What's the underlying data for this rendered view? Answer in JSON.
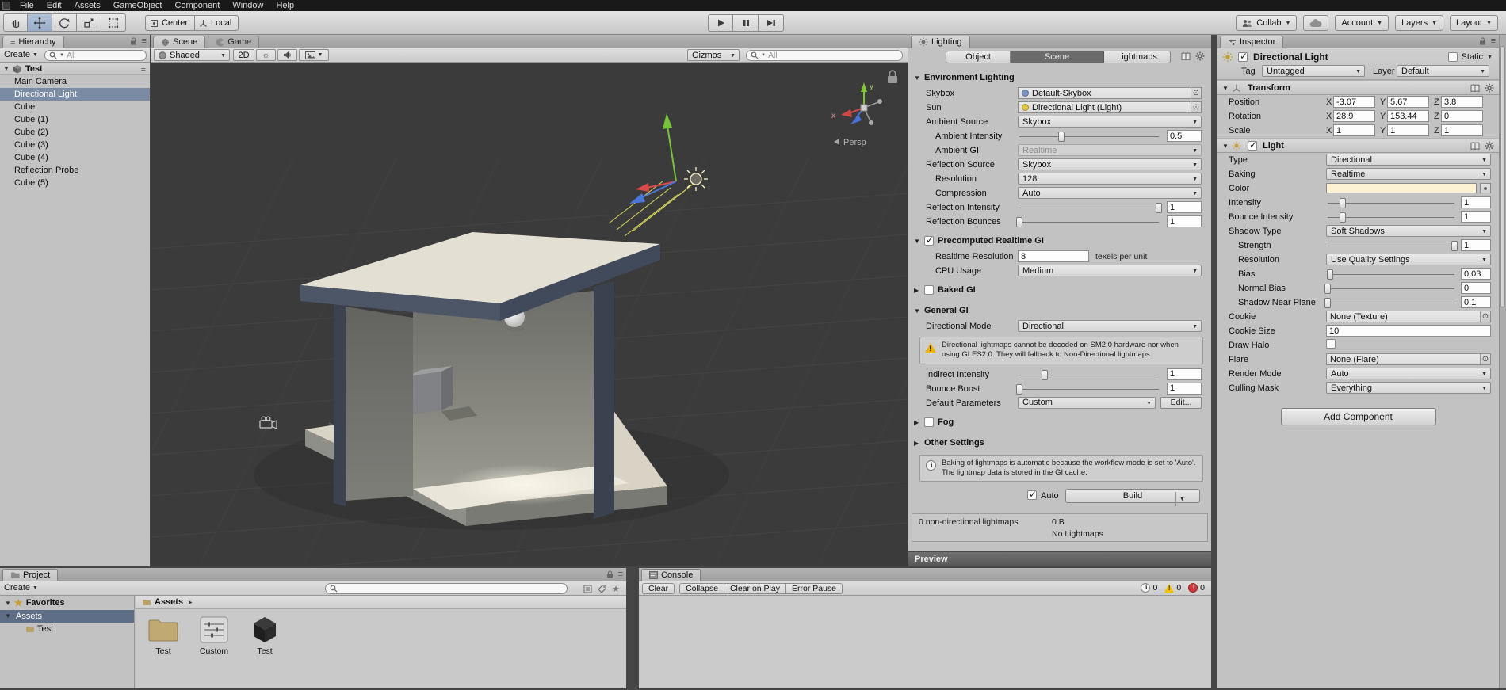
{
  "menu": {
    "items": [
      "File",
      "Edit",
      "Assets",
      "GameObject",
      "Component",
      "Window",
      "Help"
    ]
  },
  "toolbar": {
    "pivot_label": "Center",
    "space_label": "Local",
    "collab_label": "Collab",
    "account_label": "Account",
    "layers_label": "Layers",
    "layout_label": "Layout"
  },
  "hierarchy": {
    "tab_label": "Hierarchy",
    "create_label": "Create",
    "search_text": "All",
    "scene_name": "Test",
    "items": [
      {
        "label": "Main Camera",
        "selected": false
      },
      {
        "label": "Directional Light",
        "selected": true
      },
      {
        "label": "Cube",
        "selected": false
      },
      {
        "label": "Cube (1)",
        "selected": false
      },
      {
        "label": "Cube (2)",
        "selected": false
      },
      {
        "label": "Cube (3)",
        "selected": false
      },
      {
        "label": "Cube (4)",
        "selected": false
      },
      {
        "label": "Reflection Probe",
        "selected": false
      },
      {
        "label": "Cube (5)",
        "selected": false
      }
    ]
  },
  "scene": {
    "scene_tab": "Scene",
    "game_tab": "Game",
    "shading_label": "Shaded",
    "btn_2d": "2D",
    "gizmos_label": "Gizmos",
    "search_text": "All",
    "persp_label": "Persp",
    "axis_y_label": "y",
    "axis_x_label": "x"
  },
  "lighting": {
    "tab_label": "Lighting",
    "mode_tabs": [
      "Object",
      "Scene",
      "Lightmaps"
    ],
    "active_mode_tab": "Scene",
    "rows": [
      {
        "kind": "header",
        "label": "Environment Lighting",
        "open": true
      },
      {
        "kind": "object",
        "label": "Skybox",
        "value": "Default-Skybox",
        "indent": 1,
        "icon": "#7a93c9"
      },
      {
        "kind": "object",
        "label": "Sun",
        "value": "Directional Light (Light)",
        "indent": 1,
        "icon": "#e0c63e"
      },
      {
        "kind": "dropdown",
        "label": "Ambient Source",
        "value": "Skybox",
        "indent": 1
      },
      {
        "kind": "slider",
        "label": "Ambient Intensity",
        "value": "0.5",
        "pos": 30,
        "indent": 2
      },
      {
        "kind": "dropdown",
        "label": "Ambient GI",
        "value": "Realtime",
        "indent": 2,
        "disabled": true
      },
      {
        "kind": "dropdown",
        "label": "Reflection Source",
        "value": "Skybox",
        "indent": 1
      },
      {
        "kind": "dropdown",
        "label": "Resolution",
        "value": "128",
        "indent": 2
      },
      {
        "kind": "dropdown",
        "label": "Compression",
        "value": "Auto",
        "indent": 2
      },
      {
        "kind": "slider",
        "label": "Reflection Intensity",
        "value": "1",
        "pos": 100,
        "indent": 1
      },
      {
        "kind": "slider",
        "label": "Reflection Bounces",
        "value": "1",
        "pos": 0,
        "indent": 1
      },
      {
        "kind": "header",
        "label": "Precomputed Realtime GI",
        "open": true,
        "checkbox": true,
        "checked": true
      },
      {
        "kind": "field_unit",
        "label": "Realtime Resolution",
        "value": "8",
        "unit": "texels per unit",
        "indent": 2
      },
      {
        "kind": "dropdown",
        "label": "CPU Usage",
        "value": "Medium",
        "indent": 2
      },
      {
        "kind": "header",
        "label": "Baked GI",
        "open": false,
        "checkbox": true,
        "checked": false
      },
      {
        "kind": "header",
        "label": "General GI",
        "open": true
      },
      {
        "kind": "dropdown",
        "label": "Directional Mode",
        "value": "Directional",
        "indent": 1
      },
      {
        "kind": "warning",
        "text": "Directional lightmaps cannot be decoded on SM2.0 hardware nor when using GLES2.0. They will fallback to Non-Directional lightmaps."
      },
      {
        "kind": "slider",
        "label": "Indirect Intensity",
        "value": "1",
        "pos": 18,
        "indent": 1
      },
      {
        "kind": "slider",
        "label": "Bounce Boost",
        "value": "1",
        "pos": 0,
        "indent": 1
      },
      {
        "kind": "dropdown_button",
        "label": "Default Parameters",
        "value": "Custom",
        "button": "Edit...",
        "indent": 1
      },
      {
        "kind": "header",
        "label": "Fog",
        "open": false,
        "checkbox": true,
        "checked": false
      },
      {
        "kind": "header",
        "label": "Other Settings",
        "open": false
      },
      {
        "kind": "info",
        "text": "Baking of lightmaps is automatic because the workflow mode is set to 'Auto'. The lightmap data is stored in the GI cache."
      }
    ],
    "auto_label": "Auto",
    "auto_checked": true,
    "build_label": "Build",
    "status_lightmaps": "0 non-directional lightmaps",
    "status_size": "0 B",
    "status_no_lightmaps": "No Lightmaps",
    "preview_label": "Preview"
  },
  "inspector": {
    "tab_label": "Inspector",
    "enabled_checked": true,
    "object_name": "Directional Light",
    "static_label": "Static",
    "tag_label": "Tag",
    "tag_value": "Untagged",
    "layer_label": "Layer",
    "layer_value": "Default",
    "transform": {
      "title": "Transform",
      "axis_labels": [
        "X",
        "Y",
        "Z"
      ],
      "rows": [
        {
          "label": "Position",
          "x": "-3.07",
          "y": "5.67",
          "z": "3.8"
        },
        {
          "label": "Rotation",
          "x": "28.9",
          "y": "153.44",
          "z": "0"
        },
        {
          "label": "Scale",
          "x": "1",
          "y": "1",
          "z": "1"
        }
      ]
    },
    "light": {
      "title": "Light",
      "enabled_checked": true,
      "rows": [
        {
          "kind": "dropdown",
          "label": "Type",
          "value": "Directional"
        },
        {
          "kind": "dropdown",
          "label": "Baking",
          "value": "Realtime"
        },
        {
          "kind": "color",
          "label": "Color",
          "swatch": "#fdf3d4"
        },
        {
          "kind": "slider",
          "label": "Intensity",
          "value": "1",
          "pos": 12
        },
        {
          "kind": "slider",
          "label": "Bounce Intensity",
          "value": "1",
          "pos": 12
        },
        {
          "kind": "dropdown",
          "label": "Shadow Type",
          "value": "Soft Shadows"
        },
        {
          "kind": "slider",
          "label": "Strength",
          "value": "1",
          "pos": 100,
          "indent": 1
        },
        {
          "kind": "dropdown",
          "label": "Resolution",
          "value": "Use Quality Settings",
          "indent": 1
        },
        {
          "kind": "slider",
          "label": "Bias",
          "value": "0.03",
          "pos": 2,
          "indent": 1
        },
        {
          "kind": "slider",
          "label": "Normal Bias",
          "value": "0",
          "pos": 0,
          "indent": 1
        },
        {
          "kind": "slider",
          "label": "Shadow Near Plane",
          "value": "0.1",
          "pos": 0,
          "indent": 1
        },
        {
          "kind": "object",
          "label": "Cookie",
          "value": "None (Texture)"
        },
        {
          "kind": "field",
          "label": "Cookie Size",
          "value": "10"
        },
        {
          "kind": "checkbox",
          "label": "Draw Halo",
          "checked": false
        },
        {
          "kind": "object",
          "label": "Flare",
          "value": "None (Flare)"
        },
        {
          "kind": "dropdown",
          "label": "Render Mode",
          "value": "Auto"
        },
        {
          "kind": "dropdown",
          "label": "Culling Mask",
          "value": "Everything"
        }
      ]
    },
    "add_component_label": "Add Component"
  },
  "project": {
    "tab_label": "Project",
    "create_label": "Create",
    "favorites_label": "Favorites",
    "tree": [
      {
        "label": "Assets",
        "selected": true,
        "indent": 0
      },
      {
        "label": "Test",
        "selected": false,
        "indent": 1
      }
    ],
    "breadcrumb": "Assets",
    "items": [
      {
        "label": "Test",
        "icon": "folder"
      },
      {
        "label": "Custom",
        "icon": "params"
      },
      {
        "label": "Test",
        "icon": "unity-scene"
      }
    ]
  },
  "console": {
    "tab_label": "Console",
    "buttons": [
      "Clear",
      "Collapse",
      "Clear on Play",
      "Error Pause"
    ],
    "counters": [
      {
        "kind": "info",
        "count": "0"
      },
      {
        "kind": "warning",
        "count": "0"
      },
      {
        "kind": "error",
        "count": "0"
      }
    ]
  }
}
